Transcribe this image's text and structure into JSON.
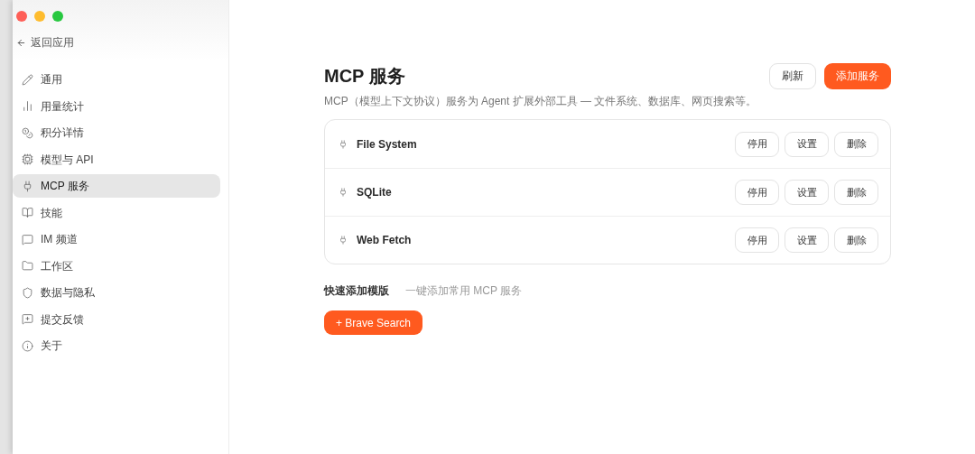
{
  "sidebar": {
    "back": "返回应用",
    "items": [
      {
        "label": "通用",
        "selected": false
      },
      {
        "label": "用量统计",
        "selected": false
      },
      {
        "label": "积分详情",
        "selected": false
      },
      {
        "label": "模型与 API",
        "selected": false
      },
      {
        "label": "MCP 服务",
        "selected": true
      },
      {
        "label": "技能",
        "selected": false
      },
      {
        "label": "IM 频道",
        "selected": false
      },
      {
        "label": "工作区",
        "selected": false
      },
      {
        "label": "数据与隐私",
        "selected": false
      },
      {
        "label": "提交反馈",
        "selected": false
      },
      {
        "label": "关于",
        "selected": false
      }
    ]
  },
  "page": {
    "title": "MCP 服务",
    "description": "MCP（模型上下文协议）服务为 Agent 扩展外部工具 — 文件系统、数据库、网页搜索等。",
    "buttons": [
      {
        "label": "刷新",
        "kind": "secondary"
      },
      {
        "label": "添加服务",
        "kind": "primary"
      }
    ]
  },
  "servers": [
    {
      "name": "File System",
      "actions": [
        "停用",
        "设置",
        "删除"
      ]
    },
    {
      "name": "SQLite",
      "actions": [
        "停用",
        "设置",
        "删除"
      ]
    },
    {
      "name": "Web Fetch",
      "actions": [
        "停用",
        "设置",
        "删除"
      ]
    }
  ],
  "templates": {
    "title": "快速添加模版",
    "hint": "一键添加常用 MCP 服务",
    "items": [
      "+ Brave Search"
    ]
  }
}
